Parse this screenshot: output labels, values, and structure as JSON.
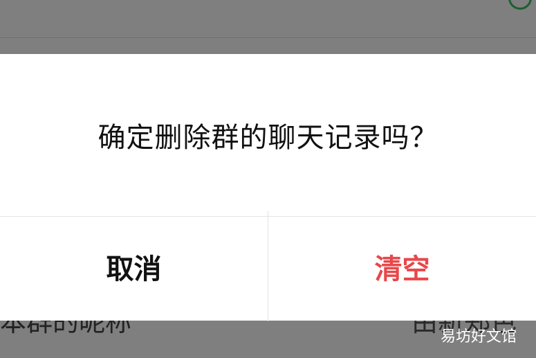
{
  "background": {
    "top_text": "",
    "row_left": "本群的昵称",
    "row_right": "由新郑色"
  },
  "dialog": {
    "message": "确定删除群的聊天记录吗？",
    "cancel_label": "取消",
    "confirm_label": "清空"
  },
  "colors": {
    "confirm": "#e8474a",
    "overlay": "#7f7f7f"
  },
  "watermark": "易坊好文馆"
}
